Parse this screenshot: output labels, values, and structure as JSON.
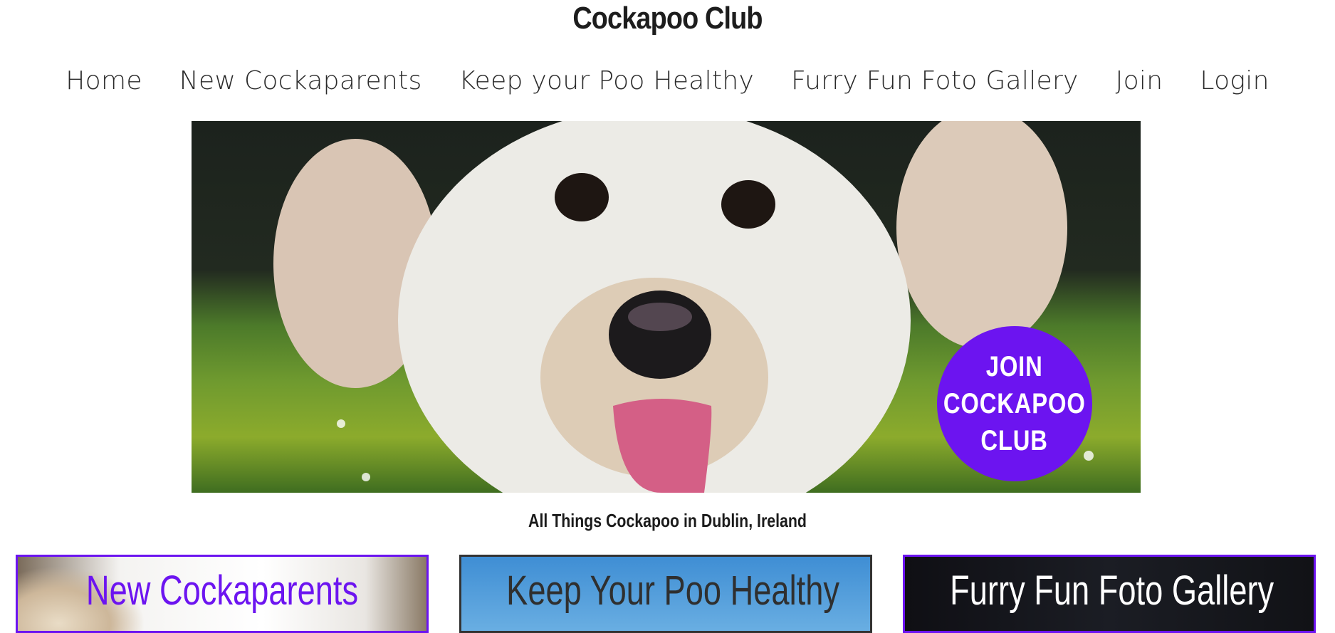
{
  "site": {
    "title": "Cockapoo Club"
  },
  "nav": {
    "items": [
      {
        "label": "Home"
      },
      {
        "label": "New Cockaparents"
      },
      {
        "label": "Keep your Poo Healthy"
      },
      {
        "label": "Furry Fun Foto Gallery"
      },
      {
        "label": "Join"
      },
      {
        "label": "Login"
      }
    ]
  },
  "hero": {
    "badge_lines": [
      "JOIN",
      "COCKAPOO",
      "CLUB"
    ],
    "badge_color": "#6c14f0"
  },
  "tagline": "All Things Cockapoo in Dublin, Ireland",
  "cards": [
    {
      "title": "New Cockaparents",
      "title_color": "#6c14f0"
    },
    {
      "title": "Keep Your Poo Healthy",
      "title_color": "#2f2f2f"
    },
    {
      "title": "Furry Fun Foto Gallery",
      "title_color": "#ffffff"
    }
  ]
}
